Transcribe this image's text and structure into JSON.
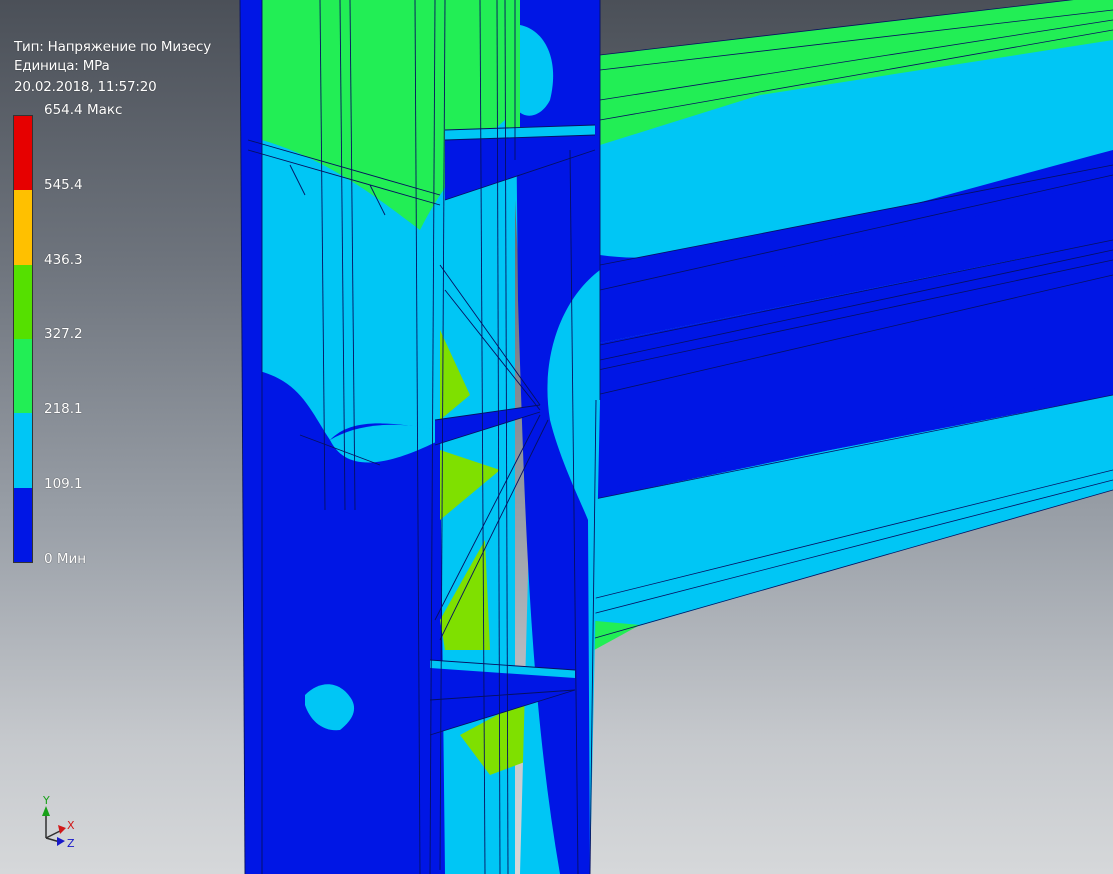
{
  "legend": {
    "type_line": "Тип: Напряжение по Мизесу",
    "unit_line": "Единица: MPa",
    "timestamp_line": "20.02.2018, 11:57:20",
    "scale_bands": [
      "#e60000",
      "#ffc000",
      "#55e000",
      "#22ee55",
      "#00c6f5",
      "#0016e5"
    ],
    "ticks": [
      {
        "label": "654.4 Макс"
      },
      {
        "label": "545.4"
      },
      {
        "label": "436.3"
      },
      {
        "label": "327.2"
      },
      {
        "label": "218.1"
      },
      {
        "label": "109.1"
      },
      {
        "label": "0 Мин"
      }
    ]
  },
  "triad": {
    "x_label": "X",
    "y_label": "Y",
    "z_label": "Z",
    "x_color": "#d01818",
    "y_color": "#18a018",
    "z_color": "#1818c8"
  },
  "colors": {
    "dark_blue": "#0016e5",
    "light_blue": "#00c6f5",
    "green": "#22ee55",
    "lime": "#7fe000"
  }
}
